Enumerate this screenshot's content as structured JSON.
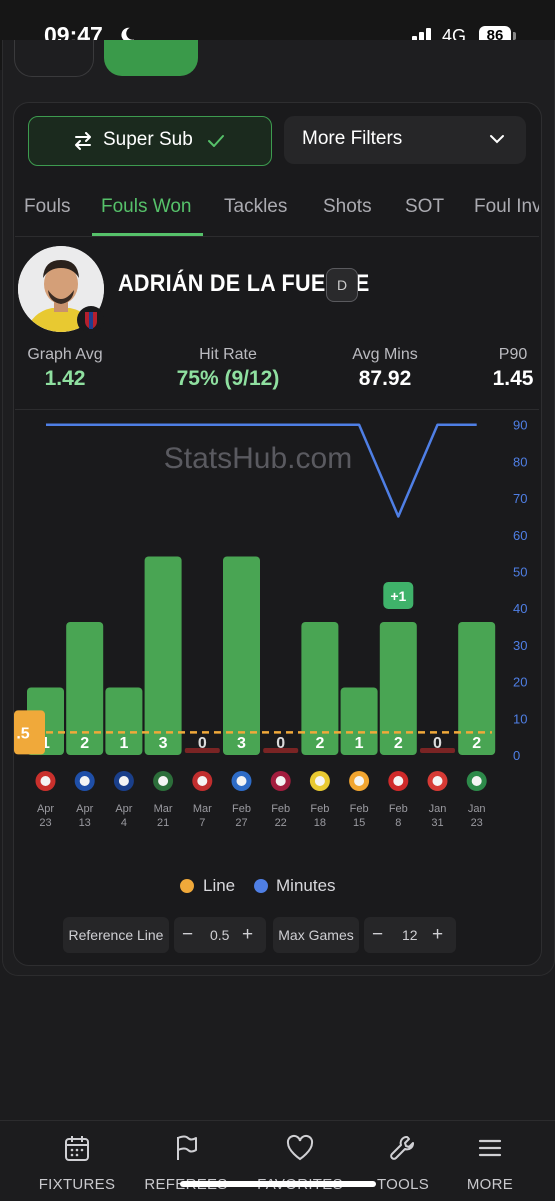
{
  "status": {
    "time": "09:47",
    "network": "4G",
    "battery": "86"
  },
  "filters": {
    "super_sub_label": "Super Sub",
    "more_filters_label": "More Filters"
  },
  "tabs": [
    "Fouls",
    "Fouls Won",
    "Tackles",
    "Shots",
    "SOT",
    "Foul Inv"
  ],
  "active_tab": "Fouls Won",
  "player": {
    "name": "ADRIÁN DE LA FUENTE",
    "position": "D"
  },
  "stats": [
    {
      "label": "Graph Avg",
      "value": "1.42"
    },
    {
      "label": "Hit Rate",
      "value": "75% (9/12)"
    },
    {
      "label": "Avg Mins",
      "value": "87.92"
    },
    {
      "label": "P90",
      "value": "1.45"
    }
  ],
  "watermark": "StatsHub.com",
  "chart_data": {
    "type": "bar",
    "categories": [
      "Apr 23",
      "Apr 13",
      "Apr 4",
      "Mar 21",
      "Mar 7",
      "Feb 27",
      "Feb 22",
      "Feb 18",
      "Feb 15",
      "Feb 8",
      "Jan 31",
      "Jan 23"
    ],
    "date_top": [
      "Apr",
      "Apr",
      "Apr",
      "Mar",
      "Mar",
      "Feb",
      "Feb",
      "Feb",
      "Feb",
      "Feb",
      "Jan",
      "Jan"
    ],
    "date_bottom": [
      "23",
      "13",
      "4",
      "21",
      "7",
      "27",
      "22",
      "18",
      "15",
      "8",
      "31",
      "23"
    ],
    "opponents": [
      "sevilla",
      "getafe",
      "real-sociedad",
      "oviedo",
      "girona",
      "alaves",
      "barcelona",
      "villarreal",
      "valencia",
      "athletic",
      "atletico",
      "elche"
    ],
    "series": [
      {
        "values": [
          1,
          2,
          1,
          3,
          0,
          3,
          0,
          2,
          1,
          2,
          0,
          2
        ]
      },
      {
        "name": "Minutes",
        "values": [
          90,
          90,
          90,
          90,
          90,
          90,
          90,
          90,
          90,
          65,
          90,
          90
        ]
      }
    ],
    "y_right_ticks": [
      "0",
      "10",
      "20",
      "30",
      "40",
      "50",
      "60",
      "70",
      "80",
      "90"
    ],
    "minutes_range": [
      0,
      90
    ],
    "line_value": 0.5,
    "line_label": ".5",
    "annotation": {
      "index": 9,
      "text": "+1"
    },
    "colors": {
      "bar": "#49a553",
      "bar_zero": "#7a2424",
      "line": "#f0a93a",
      "minutes": "#4f7fe5"
    },
    "legend": [
      "Line",
      "Minutes"
    ],
    "legend_position": "bottom-center"
  },
  "controls": {
    "reference_line_label": "Reference Line",
    "reference_value": "0.5",
    "max_games_label": "Max Games",
    "max_games_value": "12",
    "minus": "−",
    "plus": "+"
  },
  "nav": [
    "FIXTURES",
    "REFEREES",
    "FAVORITES",
    "TOOLS",
    "MORE"
  ]
}
